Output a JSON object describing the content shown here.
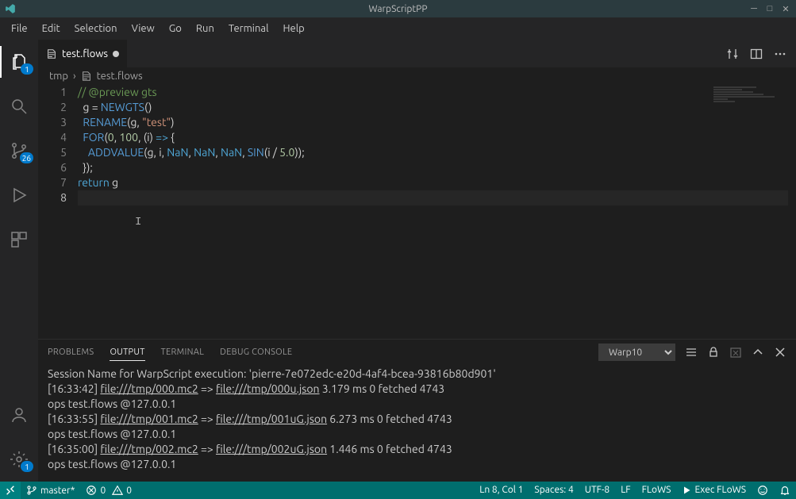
{
  "window": {
    "title": "WarpScriptPP"
  },
  "menu": [
    "File",
    "Edit",
    "Selection",
    "View",
    "Go",
    "Run",
    "Terminal",
    "Help"
  ],
  "activity": {
    "explorer_badge": "1",
    "scm_badge": "26",
    "settings_badge": "1"
  },
  "tab": {
    "filename": "test.flows"
  },
  "breadcrumbs": {
    "root": "tmp",
    "file": "test.flows"
  },
  "code": {
    "lines": [
      {
        "n": "1",
        "segments": [
          [
            "comment",
            "// @preview gts"
          ]
        ]
      },
      {
        "n": "2",
        "segments": [
          [
            "ident",
            "g "
          ],
          [
            "punc",
            "= "
          ],
          [
            "fn",
            "NEWGTS"
          ],
          [
            "punc",
            "()"
          ]
        ]
      },
      {
        "n": "3",
        "segments": [
          [
            "fn",
            "RENAME"
          ],
          [
            "punc",
            "(g, "
          ],
          [
            "str",
            "\"test\""
          ],
          [
            "punc",
            ")"
          ]
        ]
      },
      {
        "n": "4",
        "segments": [
          [
            "fn",
            "FOR"
          ],
          [
            "punc",
            "("
          ],
          [
            "num",
            "0"
          ],
          [
            "punc",
            ", "
          ],
          [
            "num",
            "100"
          ],
          [
            "punc",
            ", (i) "
          ],
          [
            "kw",
            "=>"
          ],
          [
            "punc",
            " {"
          ]
        ]
      },
      {
        "n": "5",
        "segments": [
          [
            "ident",
            "  "
          ],
          [
            "fn",
            "ADDVALUE"
          ],
          [
            "punc",
            "(g, i, "
          ],
          [
            "kw",
            "NaN"
          ],
          [
            "punc",
            ", "
          ],
          [
            "kw",
            "NaN"
          ],
          [
            "punc",
            ", "
          ],
          [
            "kw",
            "NaN"
          ],
          [
            "punc",
            ", "
          ],
          [
            "fn",
            "SIN"
          ],
          [
            "punc",
            "(i / "
          ],
          [
            "num",
            "5.0"
          ],
          [
            "punc",
            "));"
          ]
        ]
      },
      {
        "n": "6",
        "segments": [
          [
            "punc",
            "});"
          ]
        ]
      },
      {
        "n": "7",
        "segments": [
          [
            "kw",
            "return"
          ],
          [
            "ident",
            " g"
          ]
        ]
      },
      {
        "n": "8",
        "segments": [
          [
            "ident",
            ""
          ]
        ]
      }
    ]
  },
  "panel": {
    "tabs": {
      "problems": "Problems",
      "output": "Output",
      "terminal": "Terminal",
      "debug": "Debug Console"
    },
    "channel": "Warp10",
    "lines": [
      "Session Name for WarpScript execution: 'pierre-7e072edc-e20d-4af4-bcea-93816b80d901'",
      "[16:33:42] file:///tmp/000.mc2 => file:///tmp/000u.json   3.179 ms        0 fetched       4743",
      "ops           test.flows @127.0.0.1",
      "[16:33:55] file:///tmp/001.mc2 => file:///tmp/001uG.json   6.273 ms        0 fetched       4743",
      "ops           test.flows @127.0.0.1",
      "[16:35:00] file:///tmp/002.mc2 => file:///tmp/002uG.json   1.446 ms        0 fetched       4743",
      "ops           test.flows @127.0.0.1"
    ]
  },
  "status": {
    "branch": "master*",
    "errors": "0",
    "warnings": "0",
    "cursor": "Ln 8, Col 1",
    "spaces": "Spaces: 4",
    "encoding": "UTF-8",
    "eol": "LF",
    "lang": "FLoWS",
    "exec": "Exec FLoWS"
  }
}
